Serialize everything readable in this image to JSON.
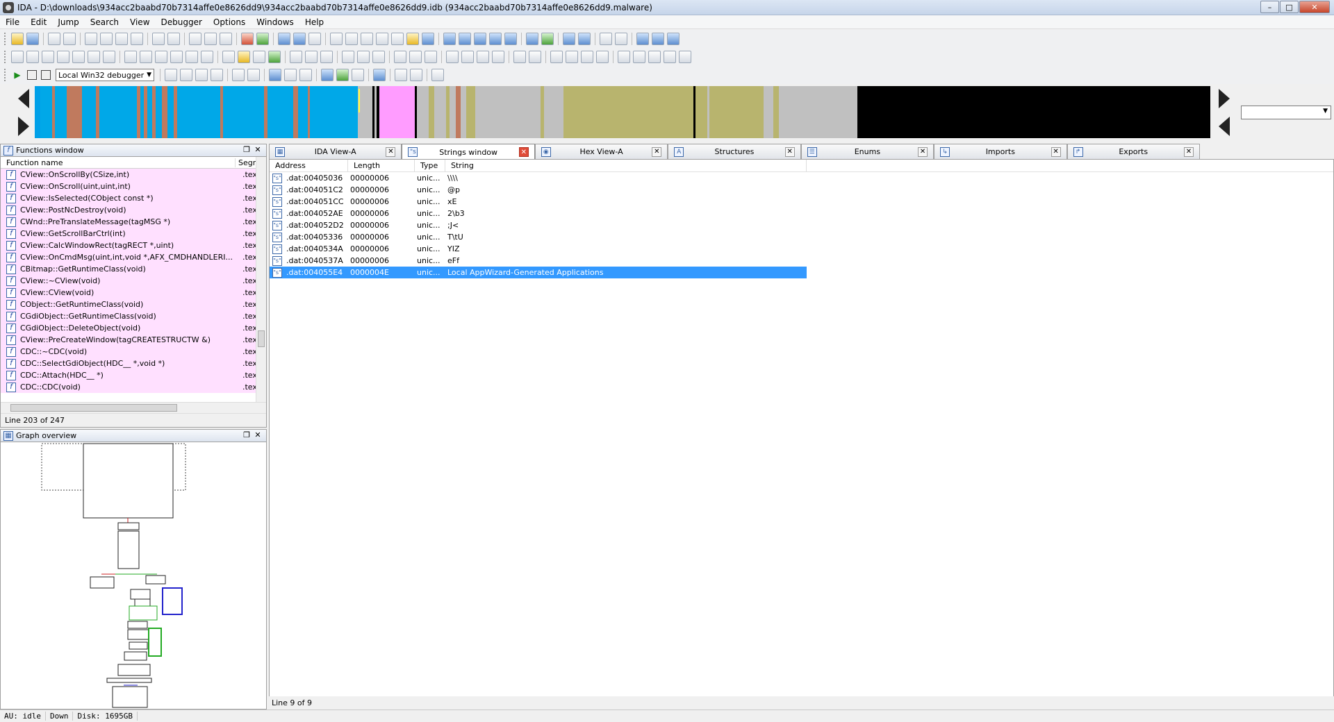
{
  "window": {
    "title": "IDA - D:\\downloads\\934acc2baabd70b7314affe0e8626dd9\\934acc2baabd70b7314affe0e8626dd9.idb (934acc2baabd70b7314affe0e8626dd9.malware)",
    "minimize": "–",
    "restore": "□",
    "close": "✕"
  },
  "menu": [
    "File",
    "Edit",
    "Jump",
    "Search",
    "View",
    "Debugger",
    "Options",
    "Windows",
    "Help"
  ],
  "debugger": {
    "selected": "Local Win32 debugger"
  },
  "navbar": {
    "segments": [
      {
        "start": 0,
        "end": 0.005,
        "color": "#00a0e8"
      },
      {
        "start": 0.005,
        "end": 0.027,
        "color": "#00a8e8"
      },
      {
        "start": 0.015,
        "end": 0.017,
        "color": "#c07a5e"
      },
      {
        "start": 0.027,
        "end": 0.04,
        "color": "#c07a5e"
      },
      {
        "start": 0.04,
        "end": 0.275,
        "color": "#00a8e8"
      },
      {
        "start": 0.052,
        "end": 0.055,
        "color": "#c07a5e"
      },
      {
        "start": 0.087,
        "end": 0.09,
        "color": "#c07a5e"
      },
      {
        "start": 0.093,
        "end": 0.096,
        "color": "#c07a5e"
      },
      {
        "start": 0.1,
        "end": 0.103,
        "color": "#c07a5e"
      },
      {
        "start": 0.108,
        "end": 0.113,
        "color": "#c07a5e"
      },
      {
        "start": 0.118,
        "end": 0.121,
        "color": "#c07a5e"
      },
      {
        "start": 0.158,
        "end": 0.16,
        "color": "#c07a5e"
      },
      {
        "start": 0.195,
        "end": 0.198,
        "color": "#c07a5e"
      },
      {
        "start": 0.22,
        "end": 0.224,
        "color": "#c07a5e"
      },
      {
        "start": 0.232,
        "end": 0.234,
        "color": "#c07a5e"
      },
      {
        "start": 0.275,
        "end": 0.287,
        "color": "#c0c0c0"
      },
      {
        "start": 0.287,
        "end": 0.289,
        "color": "#000000"
      },
      {
        "start": 0.291,
        "end": 0.293,
        "color": "#000000"
      },
      {
        "start": 0.293,
        "end": 0.323,
        "color": "#ff9cff"
      },
      {
        "start": 0.323,
        "end": 0.325,
        "color": "#000000"
      },
      {
        "start": 0.325,
        "end": 0.38,
        "color": "#c0c0c0"
      },
      {
        "start": 0.335,
        "end": 0.34,
        "color": "#b8b46e"
      },
      {
        "start": 0.35,
        "end": 0.353,
        "color": "#b8b46e"
      },
      {
        "start": 0.358,
        "end": 0.362,
        "color": "#c07a5e"
      },
      {
        "start": 0.367,
        "end": 0.375,
        "color": "#b8b46e"
      },
      {
        "start": 0.43,
        "end": 0.433,
        "color": "#b8b46e"
      },
      {
        "start": 0.45,
        "end": 0.56,
        "color": "#b8b46e"
      },
      {
        "start": 0.56,
        "end": 0.562,
        "color": "#000000"
      },
      {
        "start": 0.562,
        "end": 0.62,
        "color": "#b8b46e"
      },
      {
        "start": 0.572,
        "end": 0.574,
        "color": "#c0c0c0"
      },
      {
        "start": 0.628,
        "end": 0.633,
        "color": "#b8b46e"
      },
      {
        "start": 0.7,
        "end": 1,
        "color": "#000000"
      }
    ]
  },
  "functions_window": {
    "title": "Functions window",
    "col_name": "Function name",
    "col_seg": "Segm",
    "rows": [
      {
        "name": "CView::OnScrollBy(CSize,int)",
        "seg": ".text"
      },
      {
        "name": "CView::OnScroll(uint,uint,int)",
        "seg": ".text"
      },
      {
        "name": "CView::IsSelected(CObject const *)",
        "seg": ".text"
      },
      {
        "name": "CView::PostNcDestroy(void)",
        "seg": ".text"
      },
      {
        "name": "CWnd::PreTranslateMessage(tagMSG *)",
        "seg": ".text"
      },
      {
        "name": "CView::GetScrollBarCtrl(int)",
        "seg": ".text"
      },
      {
        "name": "CView::CalcWindowRect(tagRECT *,uint)",
        "seg": ".text"
      },
      {
        "name": "CView::OnCmdMsg(uint,int,void *,AFX_CMDHANDLERI...",
        "seg": ".text"
      },
      {
        "name": "CBitmap::GetRuntimeClass(void)",
        "seg": ".text"
      },
      {
        "name": "CView::~CView(void)",
        "seg": ".text"
      },
      {
        "name": "CView::CView(void)",
        "seg": ".text"
      },
      {
        "name": "CObject::GetRuntimeClass(void)",
        "seg": ".text"
      },
      {
        "name": "CGdiObject::GetRuntimeClass(void)",
        "seg": ".text"
      },
      {
        "name": "CGdiObject::DeleteObject(void)",
        "seg": ".text"
      },
      {
        "name": "CView::PreCreateWindow(tagCREATESTRUCTW &)",
        "seg": ".text"
      },
      {
        "name": "CDC::~CDC(void)",
        "seg": ".text"
      },
      {
        "name": "CDC::SelectGdiObject(HDC__ *,void *)",
        "seg": ".text"
      },
      {
        "name": "CDC::Attach(HDC__ *)",
        "seg": ".text"
      },
      {
        "name": "CDC::CDC(void)",
        "seg": ".text"
      }
    ],
    "status": "Line 203 of 247"
  },
  "graph_overview": {
    "title": "Graph overview"
  },
  "tabs": [
    {
      "label": "IDA View-A",
      "active": false
    },
    {
      "label": "Strings window",
      "active": true
    },
    {
      "label": "Hex View-A",
      "active": false
    },
    {
      "label": "Structures",
      "active": false
    },
    {
      "label": "Enums",
      "active": false
    },
    {
      "label": "Imports",
      "active": false
    },
    {
      "label": "Exports",
      "active": false
    }
  ],
  "strings_window": {
    "col_address": "Address",
    "col_length": "Length",
    "col_type": "Type",
    "col_string": "String",
    "rows": [
      {
        "address": ".dat:00405036",
        "length": "00000006",
        "type": "unic...",
        "string": "\\\\\\\\"
      },
      {
        "address": ".dat:004051C2",
        "length": "00000006",
        "type": "unic...",
        "string": "@p"
      },
      {
        "address": ".dat:004051CC",
        "length": "00000006",
        "type": "unic...",
        "string": "xE"
      },
      {
        "address": ".dat:004052AE",
        "length": "00000006",
        "type": "unic...",
        "string": "2\\b3"
      },
      {
        "address": ".dat:004052D2",
        "length": "00000006",
        "type": "unic...",
        "string": ";J<"
      },
      {
        "address": ".dat:00405336",
        "length": "00000006",
        "type": "unic...",
        "string": "T\\tU"
      },
      {
        "address": ".dat:0040534A",
        "length": "00000006",
        "type": "unic...",
        "string": "YIZ"
      },
      {
        "address": ".dat:0040537A",
        "length": "00000006",
        "type": "unic...",
        "string": "eFf"
      },
      {
        "address": ".dat:004055E4",
        "length": "0000004E",
        "type": "unic...",
        "string": "Local AppWizard-Generated Applications",
        "selected": true
      }
    ],
    "status": "Line 9 of 9"
  },
  "statusbar": {
    "au": "AU:  idle",
    "dir": "Down",
    "disk": "Disk: 1695GB"
  }
}
